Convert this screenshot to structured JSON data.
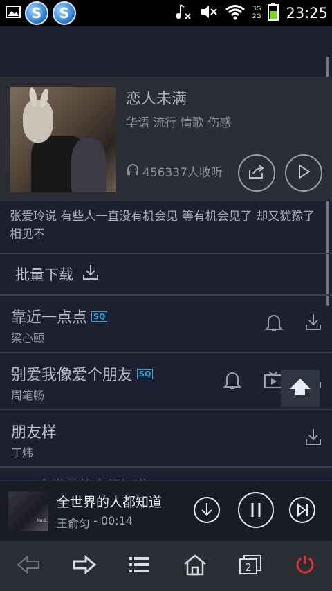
{
  "status_bar": {
    "time": "23:25",
    "network_label_1": "3G",
    "network_label_2": "2G"
  },
  "album": {
    "title": "恋人未满",
    "tags": "华语 流行 情歌 伤感",
    "listen_count": "456337人收听"
  },
  "description": "张爱玲说 有些人一直没有机会见 等有机会见了 却又犹豫了 相见不",
  "batch_download_label": "批量下载",
  "songs": [
    {
      "name": "靠近一点点",
      "artist": "梁心颐",
      "sq": "SQ"
    },
    {
      "name": "别爱我像爱个朋友",
      "artist": "周笔畅",
      "sq": "SQ"
    },
    {
      "name": "朋友样",
      "artist": "丁炜"
    }
  ],
  "faded_song": "全世界的人都知道",
  "player": {
    "title": "全世界的人都知道",
    "artist": "王俞匀",
    "separator": " - ",
    "time": "00:14",
    "cover_text": "No.1"
  },
  "colors": {
    "accent_sq": "#2aa5e0",
    "power": "#d9342b",
    "background": "#1c2030"
  }
}
